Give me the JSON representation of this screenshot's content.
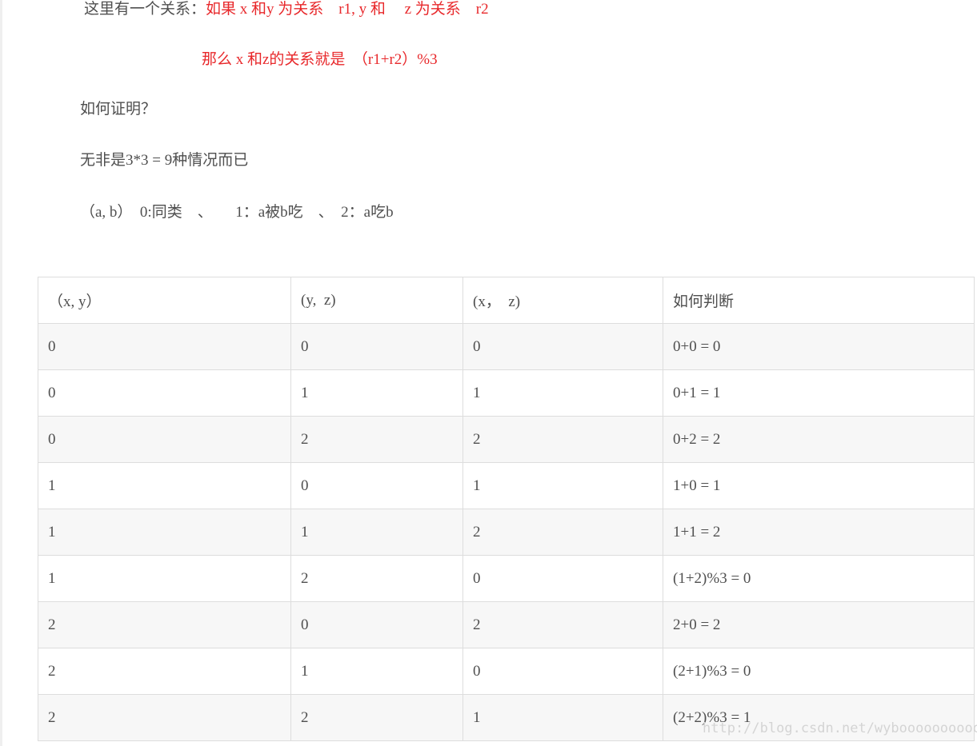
{
  "lines": {
    "l1_prefix": "这里有一个关系：",
    "l1_red": "如果 x 和y 为关系　r1, y 和　 z 为关系　r2",
    "l2": "那么 x 和z的关系就是　（r1+r2）%3",
    "l3": "如何证明？",
    "l4": "无非是3*3 = 9种情况而已",
    "l5": "（a, b）　0:同类　、　　1：a被b吃　、　2：a吃b"
  },
  "table": {
    "headers": [
      "（x, y）",
      "(y,  z)",
      "(x，  z)",
      "如何判断"
    ],
    "rows": [
      [
        "0",
        "0",
        "0",
        "0+0 = 0"
      ],
      [
        "0",
        "1",
        "1",
        "0+1 = 1"
      ],
      [
        "0",
        "2",
        "2",
        "0+2 = 2"
      ],
      [
        "1",
        "0",
        "1",
        "1+0 = 1"
      ],
      [
        "1",
        "1",
        "2",
        "1+1 = 2"
      ],
      [
        "1",
        "2",
        "0",
        "(1+2)%3 = 0"
      ],
      [
        "2",
        "0",
        "2",
        "2+0 = 2"
      ],
      [
        "2",
        "1",
        "0",
        "(2+1)%3 = 0"
      ],
      [
        "2",
        "2",
        "1",
        "(2+2)%3 = 1"
      ]
    ]
  },
  "watermark": "http://blog.csdn.net/wyboooooooooo"
}
